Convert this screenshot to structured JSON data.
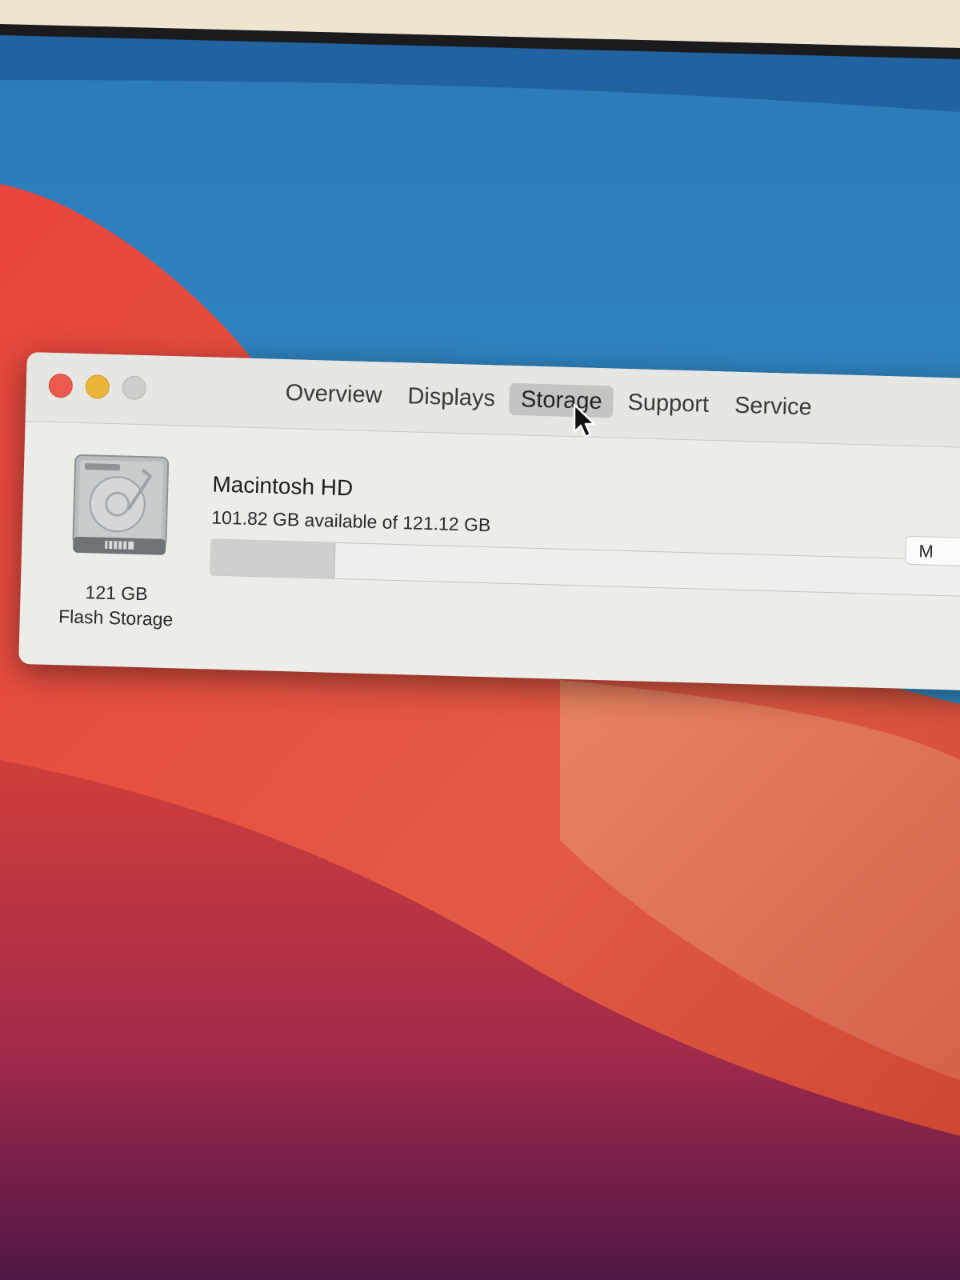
{
  "window": {
    "tabs": [
      {
        "label": "Overview",
        "active": false
      },
      {
        "label": "Displays",
        "active": false
      },
      {
        "label": "Storage",
        "active": true
      },
      {
        "label": "Support",
        "active": false
      },
      {
        "label": "Service",
        "active": false
      }
    ],
    "traffic_lights": {
      "close_color": "#ec5a4f",
      "minimize_color": "#ecb43a",
      "zoom_color": "#cdcdcb"
    }
  },
  "storage": {
    "disk_capacity": "121 GB",
    "disk_type": "Flash Storage",
    "volume_name": "Macintosh HD",
    "volume_detail": "101.82 GB available of 121.12 GB",
    "available_gb": 101.82,
    "total_gb": 121.12,
    "used_fraction": 0.16,
    "partial_button_label": "M"
  },
  "icons": {
    "disk": "internal-drive-icon",
    "cursor": "arrow-cursor-icon"
  }
}
